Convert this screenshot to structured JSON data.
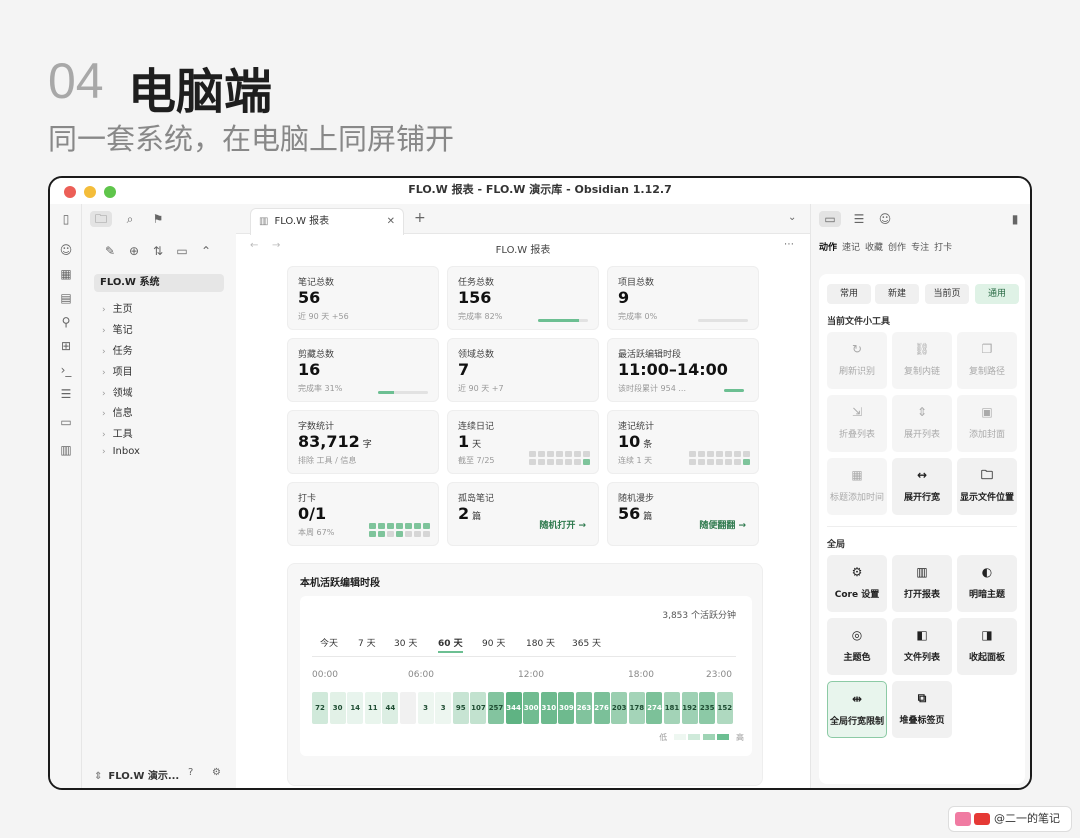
{
  "header": {
    "number": "04",
    "title": "电脑端",
    "subtitle": "同一套系统，在电脑上同屏铺开"
  },
  "window": {
    "title": "FLO.W 报表 - FLO.W 演示库 - Obsidian 1.12.7"
  },
  "file_tree": {
    "root": "FLO.W 系统",
    "items": [
      "主页",
      "笔记",
      "任务",
      "项目",
      "领域",
      "信息",
      "工具",
      "Inbox"
    ],
    "vault_name": "FLO.W 演示..."
  },
  "tab": {
    "label": "FLO.W 报表"
  },
  "page": {
    "title": "FLO.W 报表"
  },
  "cards": [
    {
      "label": "笔记总数",
      "value": "56",
      "unit": "",
      "sub": "近 90 天 +56"
    },
    {
      "label": "任务总数",
      "value": "156",
      "unit": "",
      "sub": "完成率 82%",
      "progress": 0.82
    },
    {
      "label": "项目总数",
      "value": "9",
      "unit": "",
      "sub": "完成率 0%",
      "progress": 0
    },
    {
      "label": "剪藏总数",
      "value": "16",
      "unit": "",
      "sub": "完成率 31%",
      "progress": 0.31
    },
    {
      "label": "领域总数",
      "value": "7",
      "unit": "",
      "sub": "近 90 天 +7"
    },
    {
      "label": "最活跃编辑时段",
      "value": "11:00–14:00",
      "unit": "",
      "sub": "该时段累计 954 ..."
    },
    {
      "label": "字数统计",
      "value": "83,712",
      "unit": "字",
      "sub": "排除 工具 / 信息"
    },
    {
      "label": "连续日记",
      "value": "1",
      "unit": "天",
      "sub": "截至 7/25"
    },
    {
      "label": "速记统计",
      "value": "10",
      "unit": "条",
      "sub": "连续 1 天"
    },
    {
      "label": "打卡",
      "value": "0/1",
      "unit": "",
      "sub": "本周 67%"
    },
    {
      "label": "孤岛笔记",
      "value": "2",
      "unit": "篇",
      "sub": "",
      "link": "随机打开 →"
    },
    {
      "label": "随机漫步",
      "value": "56",
      "unit": "篇",
      "sub": "",
      "link": "随便翻翻 →"
    }
  ],
  "heatmap": {
    "title": "本机活跃编辑时段",
    "total": "3,853 个活跃分钟",
    "ranges": [
      "今天",
      "7 天",
      "30 天",
      "60 天",
      "90 天",
      "180 天",
      "365 天"
    ],
    "selected_range": "60 天",
    "time_labels": [
      "00:00",
      "06:00",
      "12:00",
      "18:00",
      "23:00"
    ],
    "hours": [
      72,
      30,
      14,
      11,
      44,
      null,
      3,
      3,
      95,
      107,
      257,
      344,
      300,
      310,
      309,
      263,
      276,
      203,
      178,
      274,
      181,
      192,
      235,
      152
    ],
    "legend_low": "低",
    "legend_high": "高"
  },
  "right_panel": {
    "tabs": [
      "动作",
      "速记",
      "收藏",
      "创作",
      "专注",
      "打卡"
    ],
    "chips": [
      "常用",
      "新建",
      "当前页",
      "通用"
    ],
    "section_file": "当前文件小工具",
    "file_tools": [
      {
        "label": "刷新识别",
        "icon": "refresh-icon",
        "glyph": "↻"
      },
      {
        "label": "复制内链",
        "icon": "link-icon",
        "glyph": "⛓"
      },
      {
        "label": "复制路径",
        "icon": "copy-icon",
        "glyph": "❐"
      },
      {
        "label": "折叠列表",
        "icon": "collapse-icon",
        "glyph": "⇲"
      },
      {
        "label": "展开列表",
        "icon": "expand-icon",
        "glyph": "⇕"
      },
      {
        "label": "添加封面",
        "icon": "image-icon",
        "glyph": "▣"
      },
      {
        "label": "标题添加时间",
        "icon": "calendar-icon",
        "glyph": "▦"
      },
      {
        "label": "展开行宽",
        "icon": "width-icon",
        "glyph": "↔"
      },
      {
        "label": "显示文件位置",
        "icon": "folder-icon",
        "glyph": "🗀"
      }
    ],
    "section_global": "全局",
    "global_tools": [
      {
        "label": "Core 设置",
        "icon": "gear-icon",
        "glyph": "⚙"
      },
      {
        "label": "打开报表",
        "icon": "chart-icon",
        "glyph": "▥"
      },
      {
        "label": "明暗主题",
        "icon": "theme-icon",
        "glyph": "◐"
      },
      {
        "label": "主题色",
        "icon": "palette-icon",
        "glyph": "◎"
      },
      {
        "label": "文件列表",
        "icon": "list-icon",
        "glyph": "◧"
      },
      {
        "label": "收起面板",
        "icon": "panel-icon",
        "glyph": "◨"
      },
      {
        "label": "全局行宽限制",
        "icon": "width-limit-icon",
        "glyph": "⇹"
      },
      {
        "label": "堆叠标签页",
        "icon": "stack-icon",
        "glyph": "⧉"
      }
    ]
  },
  "credit": {
    "text": "@二一的笔记"
  },
  "colors": {
    "accent": "#6cbf92",
    "heat_low": "#eef7f1",
    "heat_high": "#5fb383"
  }
}
